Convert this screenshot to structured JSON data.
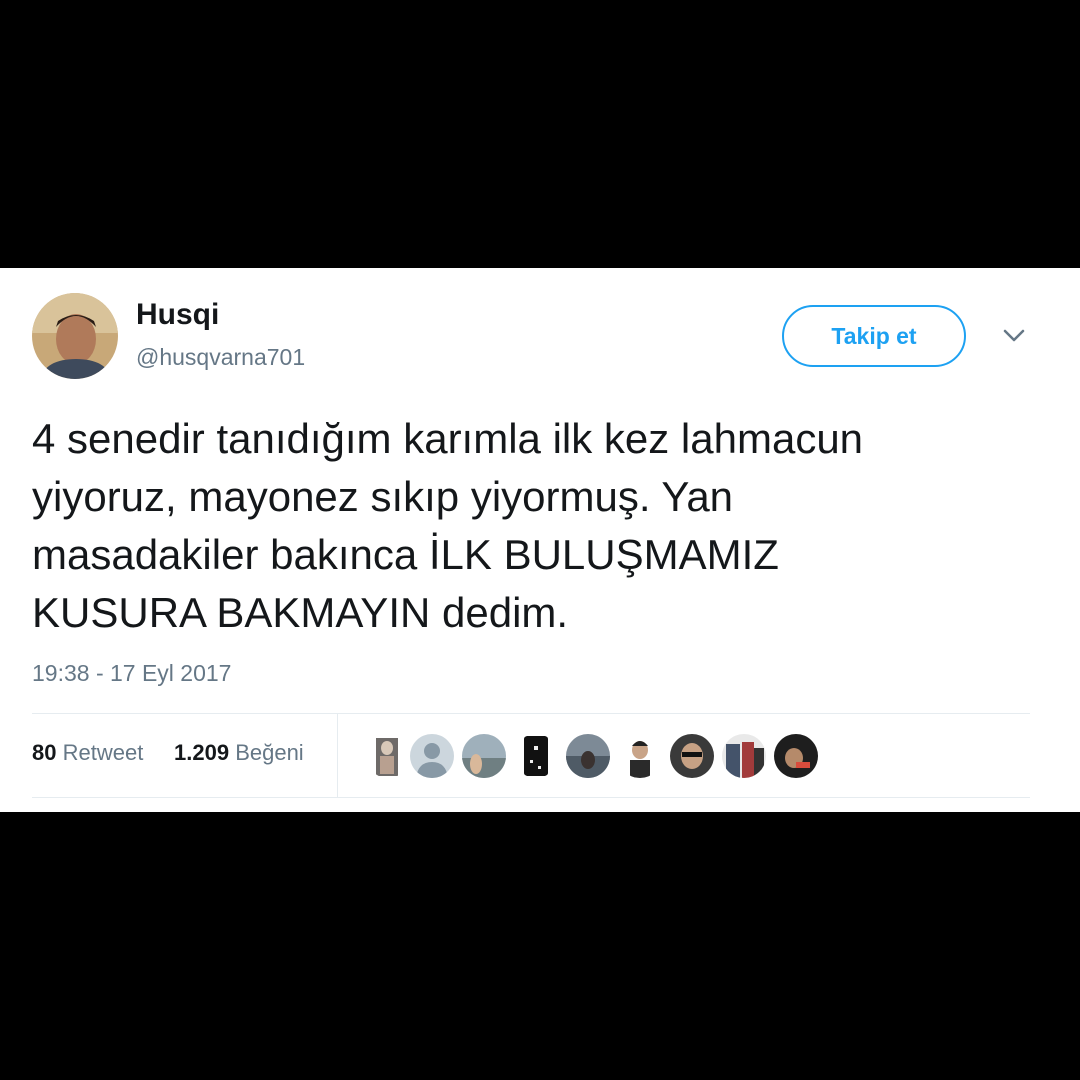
{
  "user": {
    "display_name": "Husqi",
    "handle": "@husqvarna701"
  },
  "follow_button_label": "Takip et",
  "tweet": {
    "lines": [
      "4 senedir tanıdığım karımla ilk kez lahmacun",
      "yiyoruz, mayonez sıkıp yiyormuş. Yan",
      "masadakiler bakınca İLK BULUŞMAMIZ",
      "KUSURA BAKMAYIN dedim."
    ],
    "timestamp": "19:38 - 17 Eyl 2017"
  },
  "stats": {
    "retweet_count": "80",
    "retweet_label": "Retweet",
    "like_count": "1.209",
    "like_label": "Beğeni"
  },
  "colors": {
    "accent": "#1da1f2",
    "text": "#14171a",
    "secondary_text": "#657786",
    "divider": "#e6ecf0"
  }
}
